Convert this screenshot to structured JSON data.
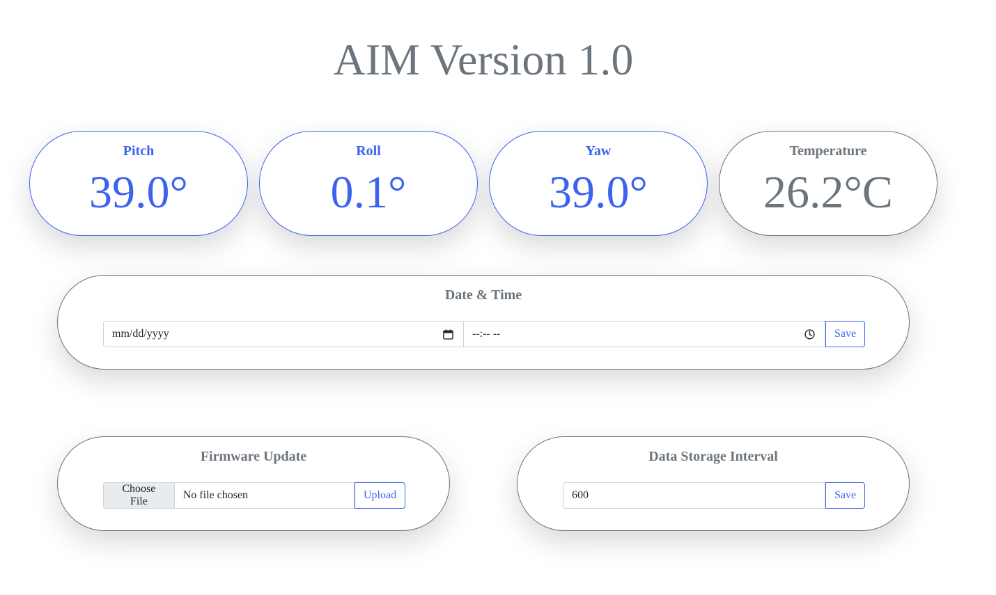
{
  "header": {
    "title": "AIM Version 1.0"
  },
  "sensors": {
    "pitch": {
      "label": "Pitch",
      "value": "39.0°"
    },
    "roll": {
      "label": "Roll",
      "value": "0.1°"
    },
    "yaw": {
      "label": "Yaw",
      "value": "39.0°"
    },
    "temperature": {
      "label": "Temperature",
      "value": "26.2°C"
    }
  },
  "datetime": {
    "title": "Date & Time",
    "date_placeholder": "mm/dd/yyyy",
    "time_placeholder": "--:-- --",
    "save_label": "Save"
  },
  "firmware": {
    "title": "Firmware Update",
    "choose_label": "Choose File",
    "file_status": "No file chosen",
    "upload_label": "Upload"
  },
  "storage": {
    "title": "Data Storage Interval",
    "value": "600",
    "save_label": "Save"
  },
  "colors": {
    "accent": "#3b63f0",
    "muted_text": "#6c757d",
    "neutral_border": "#707070"
  },
  "icons": {
    "date": "calendar-icon",
    "time": "clock-icon"
  }
}
